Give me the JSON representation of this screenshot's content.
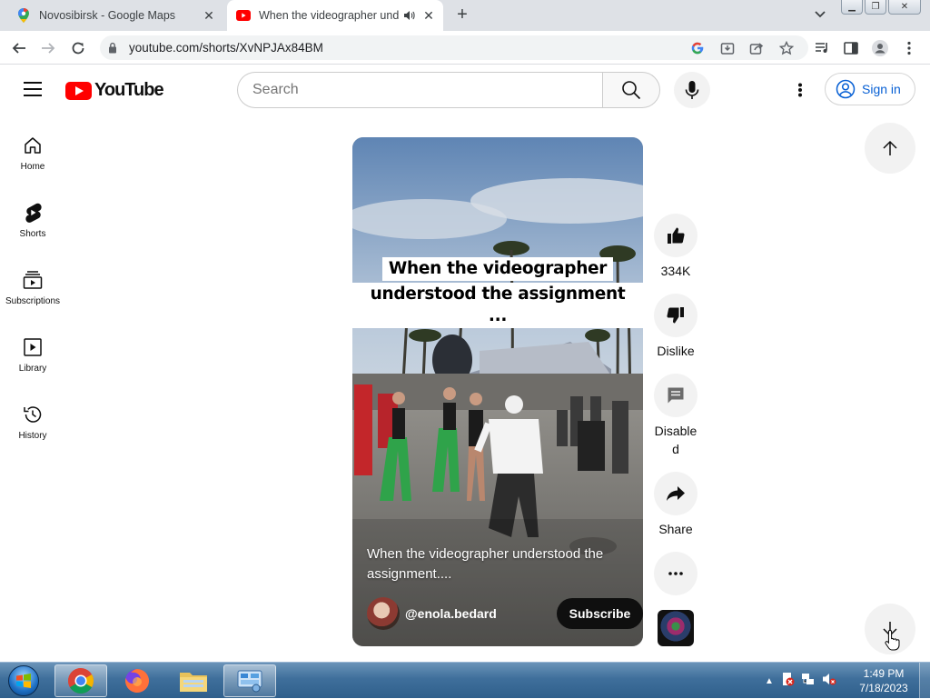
{
  "browser": {
    "tabs": [
      {
        "title": "Novosibirsk - Google Maps",
        "icon": "google-maps-icon",
        "active": false
      },
      {
        "title": "When the videographer und",
        "icon": "youtube-icon",
        "active": true,
        "audio": "speaker-icon"
      }
    ],
    "url": "youtube.com/shorts/XvNPJAx84BM"
  },
  "youtube": {
    "logo_text": "YouTube",
    "search_placeholder": "Search",
    "sign_in_label": "Sign in",
    "guide": [
      {
        "label": "Home",
        "icon": "home-icon"
      },
      {
        "label": "Shorts",
        "icon": "shorts-icon"
      },
      {
        "label": "Subscriptions",
        "icon": "subscriptions-icon"
      },
      {
        "label": "Library",
        "icon": "library-icon"
      },
      {
        "label": "History",
        "icon": "history-icon"
      }
    ],
    "short": {
      "overlay_line1": "When the videographer",
      "overlay_line2": "understood the assignment ...",
      "description": "When the videographer understood the assignment....",
      "channel": "@enola.bedard",
      "subscribe_label": "Subscribe"
    },
    "actions": {
      "like_count": "334K",
      "dislike_label": "Dislike",
      "comments_label": "Disabled",
      "share_label": "Share"
    }
  },
  "taskbar": {
    "time": "1:49 PM",
    "date": "7/18/2023"
  },
  "colors": {
    "youtube_red": "#ff0000",
    "link_blue": "#065fd4",
    "taskbar_blue": "#3f6f9b"
  }
}
